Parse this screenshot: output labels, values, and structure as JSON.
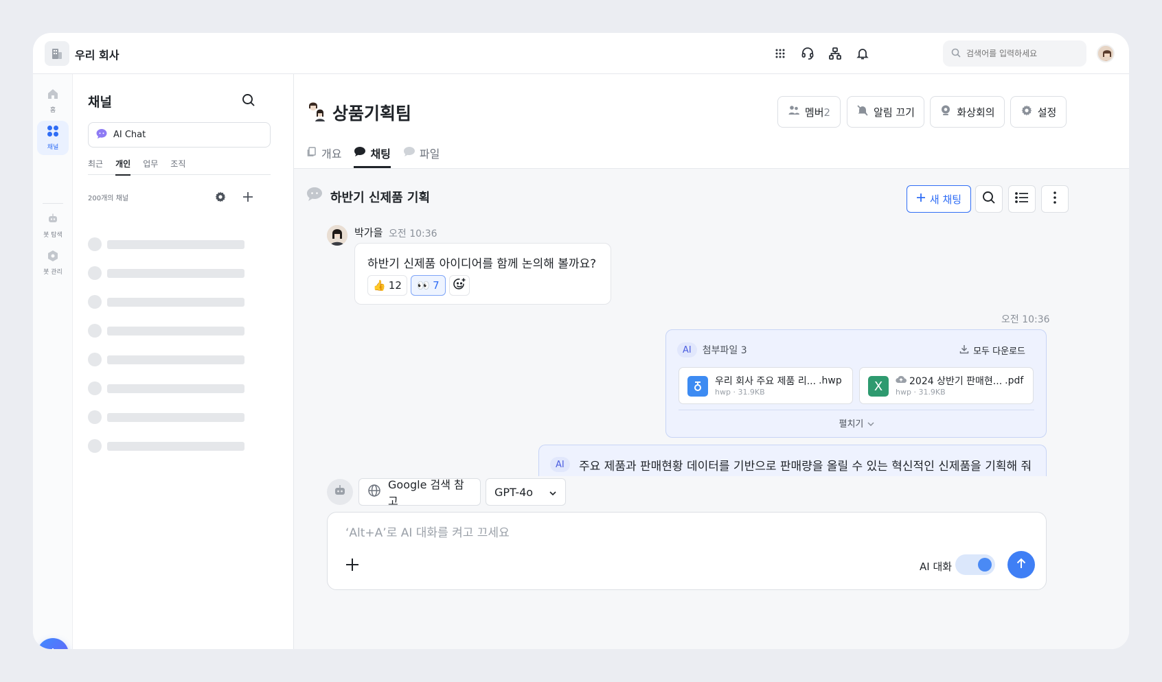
{
  "topbar": {
    "company_name": "우리 회사",
    "search_placeholder": "검색어를 입력하세요",
    "icons": [
      "apps-grid-icon",
      "headset-icon",
      "org-chart-icon",
      "bell-icon"
    ]
  },
  "rail": {
    "items": [
      {
        "label": "홈",
        "icon": "home-icon"
      },
      {
        "label": "채널",
        "icon": "channels-icon",
        "active": true
      },
      {
        "label": "봇 탐색",
        "icon": "bot-icon"
      },
      {
        "label": "봇 관리",
        "icon": "bot-settings-icon"
      }
    ]
  },
  "channel_panel": {
    "title": "채널",
    "ai_chat_label": "AI Chat",
    "tabs": [
      "최근",
      "개인",
      "업무",
      "조직"
    ],
    "active_tab": "개인",
    "channel_count": "200개의 채널"
  },
  "header": {
    "team_name": "상품기획팀",
    "buttons": {
      "members_label": "멤버",
      "members_count": "2",
      "mute_label": "알림 끄기",
      "video_label": "화상회의",
      "settings_label": "설정"
    },
    "tabs": [
      "개요",
      "채팅",
      "파일"
    ],
    "active_tab": "채팅"
  },
  "thread": {
    "title": "하반기 신제품 기획",
    "new_chat_label": "새 채팅"
  },
  "messages": {
    "first": {
      "sender": "박가을",
      "time": "오전 10:36",
      "text": "하반기 신제품 아이디어를 함께 논의해 볼까요?",
      "reactions": [
        {
          "emoji": "👍",
          "count": "12"
        },
        {
          "emoji": "👀",
          "count": "7",
          "selected": true
        }
      ]
    },
    "reply_time": "오전 10:36",
    "attachments": {
      "ai_tag": "AI",
      "label": "첨부파일 3",
      "download_all": "모두 다운로드",
      "files": [
        {
          "name": "우리 회사 주요 제품 리...",
          "ext": ".hwp",
          "meta": "hwp · 31.9KB",
          "color": "#3d8bf2",
          "glyph": "ㅎ"
        },
        {
          "name": "2024 상반기 판매현...",
          "ext": ".pdf",
          "meta": "hwp · 31.9KB",
          "color": "#2e9a6f",
          "glyph": "X"
        }
      ],
      "expand_label": "펼치기"
    },
    "ai_prompt": {
      "tag": "AI",
      "text": "주요 제품과 판매현황 데이터를 기반으로 판매량을 올릴 수 있는 혁신적인 신제품을 기획해 줘"
    }
  },
  "composer": {
    "google_ref_label": "Google 검색 참고",
    "model_label": "GPT-4o",
    "placeholder": "‘Alt+A’로 AI 대화를 켜고 끄세요",
    "ai_toggle_label": "AI 대화",
    "ai_toggle_on": true
  },
  "colors": {
    "accent": "#2f6df5",
    "ai_bubble_bg": "#eef2fe",
    "ai_bubble_border": "#c7d4f6"
  }
}
